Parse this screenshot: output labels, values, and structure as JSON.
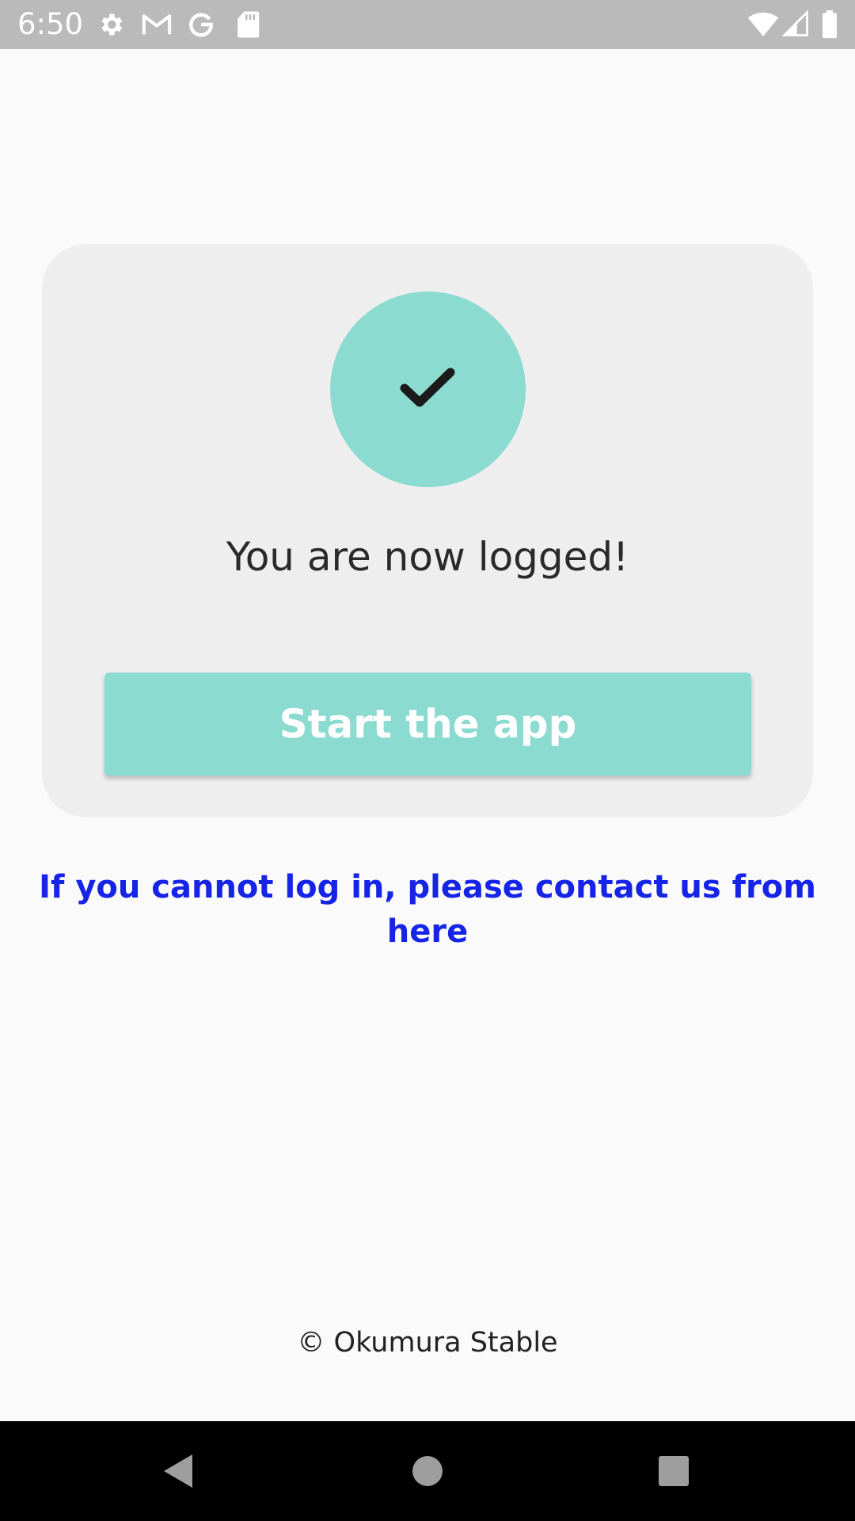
{
  "status_bar": {
    "time": "6:50",
    "left_icons": [
      "settings-icon",
      "gmail-icon",
      "google-icon",
      "sd-card-icon"
    ],
    "right_icons": [
      "wifi-icon",
      "cellular-signal-icon",
      "battery-icon"
    ]
  },
  "login_card": {
    "check_icon": "checkmark-icon",
    "message": "You are now logged!",
    "start_button_label": "Start the app"
  },
  "contact_link": "If you cannot log in, please contact us from here",
  "footer": {
    "copyright": "© Okumura Stable"
  },
  "nav_bar": {
    "buttons": [
      "back-icon",
      "home-icon",
      "recents-icon"
    ]
  },
  "colors": {
    "accent": "#8bdbd1",
    "link": "#1524e6",
    "card_background": "#eeeeee",
    "page_background": "#fafafa",
    "status_bar": "#bababa"
  }
}
